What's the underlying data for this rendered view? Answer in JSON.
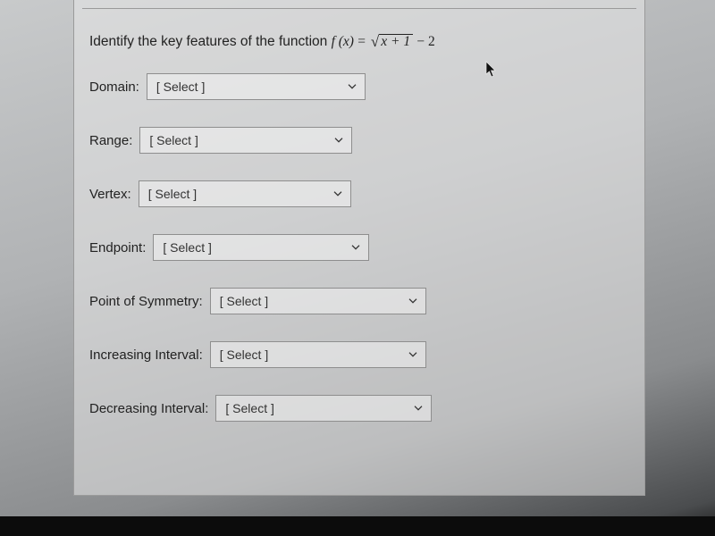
{
  "prompt": {
    "lead": "Identify the key features of the function ",
    "fx": "f (x)",
    "equals": " = ",
    "radicand": "x + 1",
    "tail": " − 2"
  },
  "placeholder": "[ Select ]",
  "fields": {
    "domain": {
      "label": "Domain:"
    },
    "range": {
      "label": "Range:"
    },
    "vertex": {
      "label": "Vertex:"
    },
    "endpoint": {
      "label": "Endpoint:"
    },
    "pos": {
      "label": "Point of Symmetry:"
    },
    "inc": {
      "label": "Increasing Interval:"
    },
    "dec": {
      "label": "Decreasing Interval:"
    }
  }
}
